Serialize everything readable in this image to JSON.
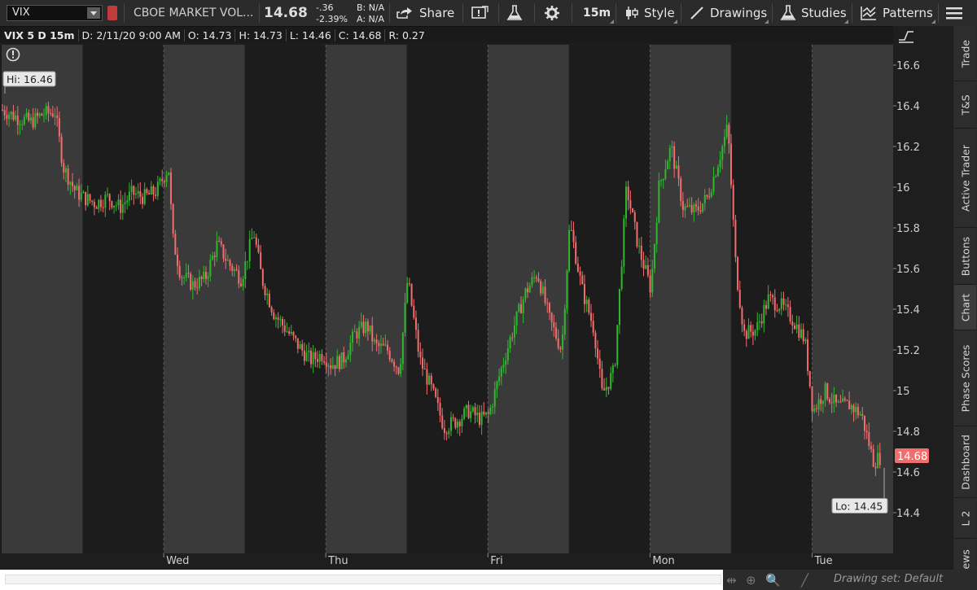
{
  "toolbar": {
    "symbol": "VIX",
    "description": "CBOE MARKET VOL...",
    "last_price": "14.68",
    "net_change": "-.36",
    "pct_change": "-2.39%",
    "bid": "B: N/A",
    "ask": "A: N/A",
    "share_label": "Share",
    "timeframe_label": "15m",
    "style_label": "Style",
    "drawings_label": "Drawings",
    "studies_label": "Studies",
    "patterns_label": "Patterns"
  },
  "info_bar": {
    "title": "VIX 5 D 15m",
    "date": "D: 2/11/20 9:00 AM",
    "open": "O: 14.73",
    "high": "H: 14.73",
    "low": "L: 14.46",
    "close": "C: 14.68",
    "range": "R: 0.27"
  },
  "side_tabs": [
    "Trade",
    "T&S",
    "Active Trader",
    "Buttons",
    "Chart",
    "Phase Scores",
    "Dashboard",
    "L 2",
    "News"
  ],
  "active_side_tab": "Chart",
  "bottom": {
    "drawing_set": "Drawing set: Default"
  },
  "colors": {
    "up": "#2fb82f",
    "down": "#f26d6d",
    "last_price_badge": "#f26d6d",
    "session_light": "#3a3a3a",
    "session_dark": "#1c1c1c"
  },
  "chart_data": {
    "type": "candlestick",
    "symbol": "VIX",
    "aggregation": "15m",
    "y_ticks": [
      "16.6",
      "16.4",
      "16.2",
      "16",
      "15.8",
      "15.6",
      "15.4",
      "15.2",
      "15",
      "14.8",
      "14.6",
      "14.4"
    ],
    "ylim": [
      14.2,
      16.7
    ],
    "x_labels": [
      "Wed",
      "Thu",
      "Fri",
      "Mon",
      "Tue"
    ],
    "session_bounds": [
      0,
      0.1,
      0.2,
      0.3,
      0.4,
      0.5,
      0.6,
      0.7,
      0.8,
      0.9,
      1.0
    ],
    "hi_label": "Hi: 16.46",
    "lo_label": "Lo: 14.45",
    "last_label": "14.68",
    "last": 14.68,
    "close_series": [
      {
        "x": 0.0,
        "y": 16.38
      },
      {
        "x": 0.02,
        "y": 16.34
      },
      {
        "x": 0.035,
        "y": 16.32
      },
      {
        "x": 0.05,
        "y": 16.36
      },
      {
        "x": 0.065,
        "y": 16.37
      },
      {
        "x": 0.075,
        "y": 16.1
      },
      {
        "x": 0.09,
        "y": 15.98
      },
      {
        "x": 0.1,
        "y": 15.95
      },
      {
        "x": 0.115,
        "y": 15.92
      },
      {
        "x": 0.13,
        "y": 15.95
      },
      {
        "x": 0.145,
        "y": 15.9
      },
      {
        "x": 0.16,
        "y": 15.97
      },
      {
        "x": 0.175,
        "y": 15.95
      },
      {
        "x": 0.19,
        "y": 15.98
      },
      {
        "x": 0.205,
        "y": 16.1
      },
      {
        "x": 0.21,
        "y": 15.75
      },
      {
        "x": 0.22,
        "y": 15.57
      },
      {
        "x": 0.235,
        "y": 15.52
      },
      {
        "x": 0.25,
        "y": 15.55
      },
      {
        "x": 0.265,
        "y": 15.72
      },
      {
        "x": 0.28,
        "y": 15.62
      },
      {
        "x": 0.295,
        "y": 15.55
      },
      {
        "x": 0.31,
        "y": 15.78
      },
      {
        "x": 0.32,
        "y": 15.55
      },
      {
        "x": 0.335,
        "y": 15.38
      },
      {
        "x": 0.35,
        "y": 15.3
      },
      {
        "x": 0.365,
        "y": 15.22
      },
      {
        "x": 0.38,
        "y": 15.15
      },
      {
        "x": 0.395,
        "y": 15.18
      },
      {
        "x": 0.405,
        "y": 15.13
      },
      {
        "x": 0.42,
        "y": 15.15
      },
      {
        "x": 0.435,
        "y": 15.28
      },
      {
        "x": 0.45,
        "y": 15.32
      },
      {
        "x": 0.46,
        "y": 15.22
      },
      {
        "x": 0.475,
        "y": 15.2
      },
      {
        "x": 0.49,
        "y": 15.1
      },
      {
        "x": 0.5,
        "y": 15.55
      },
      {
        "x": 0.515,
        "y": 15.15
      },
      {
        "x": 0.53,
        "y": 15.0
      },
      {
        "x": 0.545,
        "y": 14.82
      },
      {
        "x": 0.56,
        "y": 14.85
      },
      {
        "x": 0.575,
        "y": 14.9
      },
      {
        "x": 0.59,
        "y": 14.86
      },
      {
        "x": 0.6,
        "y": 14.88
      },
      {
        "x": 0.615,
        "y": 15.1
      },
      {
        "x": 0.63,
        "y": 15.3
      },
      {
        "x": 0.645,
        "y": 15.48
      },
      {
        "x": 0.66,
        "y": 15.58
      },
      {
        "x": 0.675,
        "y": 15.35
      },
      {
        "x": 0.69,
        "y": 15.2
      },
      {
        "x": 0.7,
        "y": 15.82
      },
      {
        "x": 0.715,
        "y": 15.5
      },
      {
        "x": 0.73,
        "y": 15.3
      },
      {
        "x": 0.74,
        "y": 14.98
      },
      {
        "x": 0.755,
        "y": 15.1
      },
      {
        "x": 0.77,
        "y": 16.0
      },
      {
        "x": 0.785,
        "y": 15.7
      },
      {
        "x": 0.8,
        "y": 15.5
      },
      {
        "x": 0.81,
        "y": 16.0
      },
      {
        "x": 0.825,
        "y": 16.2
      },
      {
        "x": 0.84,
        "y": 15.9
      },
      {
        "x": 0.855,
        "y": 15.88
      },
      {
        "x": 0.87,
        "y": 15.95
      },
      {
        "x": 0.885,
        "y": 16.15
      },
      {
        "x": 0.895,
        "y": 16.3
      },
      {
        "x": 0.905,
        "y": 15.6
      },
      {
        "x": 0.915,
        "y": 15.28
      },
      {
        "x": 0.93,
        "y": 15.3
      },
      {
        "x": 0.945,
        "y": 15.45
      },
      {
        "x": 0.96,
        "y": 15.42
      },
      {
        "x": 0.975,
        "y": 15.35
      },
      {
        "x": 0.99,
        "y": 15.25
      },
      {
        "x": 1.0,
        "y": 14.9
      },
      {
        "x": 1.015,
        "y": 15.0
      },
      {
        "x": 1.03,
        "y": 14.92
      },
      {
        "x": 1.045,
        "y": 14.93
      },
      {
        "x": 1.06,
        "y": 14.88
      },
      {
        "x": 1.075,
        "y": 14.65
      },
      {
        "x": 1.085,
        "y": 14.68
      }
    ]
  }
}
